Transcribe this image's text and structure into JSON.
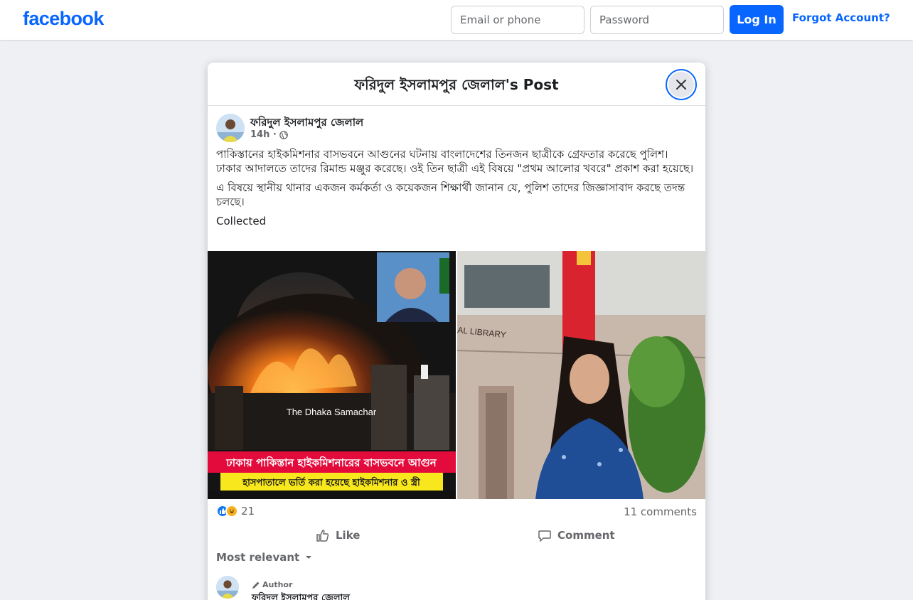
{
  "topbar": {
    "logo": "facebook",
    "email_placeholder": "Email or phone",
    "password_placeholder": "Password",
    "login_label": "Log In",
    "forgot_label": "Forgot Account?"
  },
  "modal": {
    "title": "ফরিদুল ইসলামপুর জেলাল's Post"
  },
  "post": {
    "author_name": "ফরিদুল ইসলামপুর জেলাল",
    "time": "14h ·",
    "paragraphs": [
      "পাকিস্তানের হাইকমিশনার বাসভবনে আগুনের ঘটনায় বাংলাদেশের তিনজন ছাত্রীকে গ্রেফতার করেছে পুলিশ। ঢাকার আদালতে তাদের রিমান্ড মঞ্জুর করেছে। ওই তিন ছাত্রী এই বিষয়ে \"প্রথম আলোর খবরে\" প্রকাশ করা হয়েছে।",
      "এ বিষয়ে স্থানীয় থানার একজন কর্মকর্তা ও কয়েকজন শিক্ষার্থী জানান যে, পুলিশ তাদের জিজ্ঞাসাবাদ করছে তদন্ত চলছে।"
    ],
    "footer_note": "Collected",
    "photo1": {
      "overlay_text": "The Dhaka Samachar",
      "banner_red": "ঢাকায় পাকিস্তান হাইকমিশনারের বাসভবনে আগুন",
      "banner_yellow": "হাসপাতালে ভর্তি করা হয়েছে হাইকমিশনার ও স্ত্রী"
    },
    "photo2": {
      "sign_text": "AL LIBRARY"
    },
    "reactions": {
      "count": "21",
      "types": [
        "like-icon",
        "haha-icon"
      ]
    },
    "comments_count": "11 comments",
    "like_label": "Like",
    "comment_label": "Comment",
    "sort_label": "Most relevant",
    "first_comment": {
      "badge": "Author",
      "author": "ফরিদুল ইসলামপুর জেলাল"
    }
  },
  "colors": {
    "brand": "#0866ff",
    "muted": "#65676b",
    "banner_red": "#e30b3c",
    "banner_yellow": "#f8e71c"
  }
}
